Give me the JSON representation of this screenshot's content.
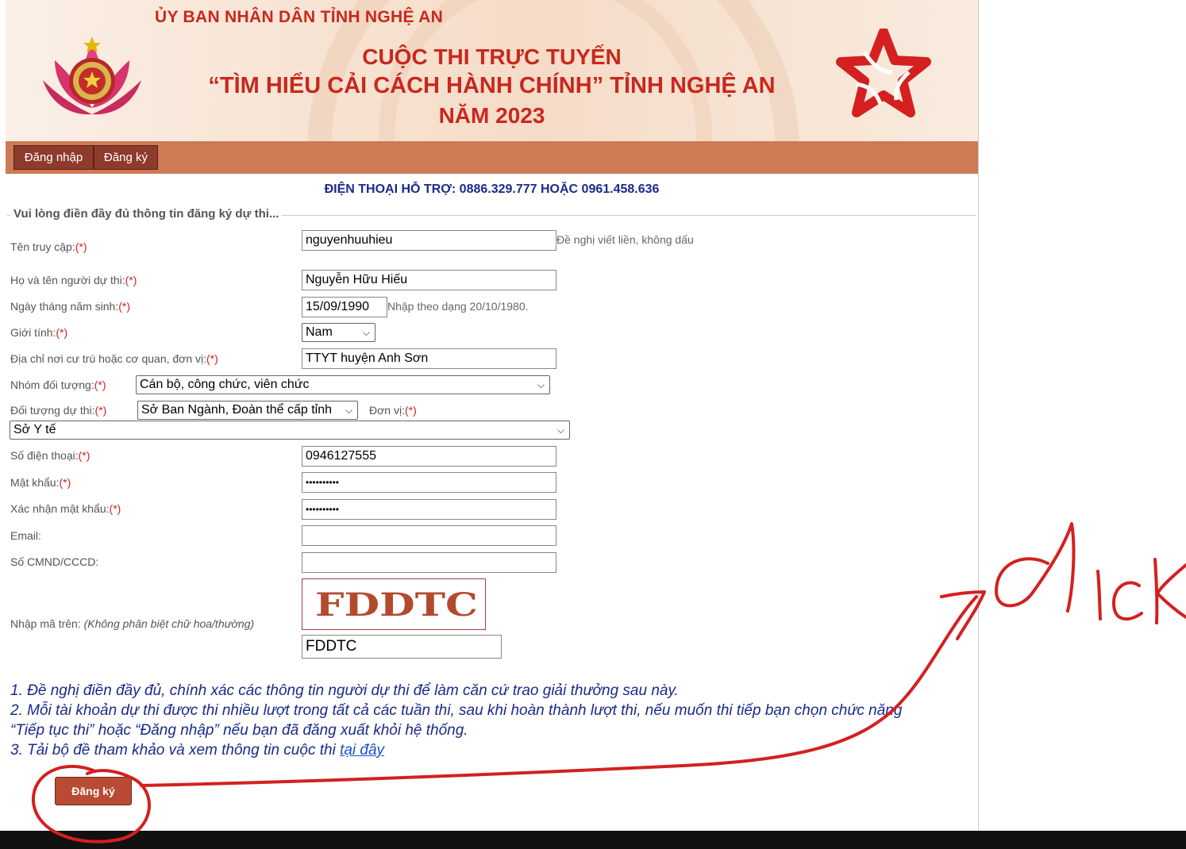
{
  "header": {
    "org": "ỦY BAN NHÂN DÂN TỈNH NGHỆ AN",
    "title_line1": "CUỘC THI TRỰC TUYẾN",
    "title_line2": "“TÌM HIỂU CẢI CÁCH HÀNH CHÍNH” TỈNH NGHỆ AN",
    "title_line3": "NĂM 2023"
  },
  "nav": {
    "login": "Đăng nhập",
    "register": "Đăng ký"
  },
  "hotline": "ĐIỆN THOẠI HỖ TRỢ: 0886.329.777 HOẶC 0961.458.636",
  "form": {
    "legend": "Vui lòng điền đầy đủ thông tin đăng ký dự thi...",
    "required_mark": "(*)",
    "username": {
      "label": "Tên truy cập:",
      "value": "nguyenhuuhieu",
      "hint": "Đề nghị viết liền, không dấu"
    },
    "fullname": {
      "label": "Họ và tên người dự thi:",
      "value": "Nguyễn Hữu Hiếu"
    },
    "dob": {
      "label": "Ngày tháng năm sinh:",
      "value": "15/09/1990",
      "hint": "Nhập theo dạng 20/10/1980."
    },
    "gender": {
      "label": "Giới tính:",
      "value": "Nam"
    },
    "address": {
      "label": "Địa chỉ nơi cư trú hoặc cơ quan, đơn vị:",
      "value": "TTYT huyện Anh Sơn"
    },
    "group": {
      "label": "Nhóm đối tượng:",
      "value": "Cán bộ, công chức, viên chức"
    },
    "target": {
      "label": "Đối tượng dự thi:",
      "value": "Sở Ban Ngành, Đoàn thể cấp tỉnh"
    },
    "unit": {
      "label": "Đơn vị:",
      "value": "Sở Y tế"
    },
    "phone": {
      "label": "Số điện thoại:",
      "value": "0946127555"
    },
    "password": {
      "label": "Mật khẩu:",
      "value": "••••••••••"
    },
    "confirm": {
      "label": "Xác nhận mật khẩu:",
      "value": "••••••••••"
    },
    "email": {
      "label": "Email:",
      "value": ""
    },
    "idcard": {
      "label": "Số CMND/CCCD:",
      "value": ""
    },
    "captcha": {
      "label": "Nhập mã trên:",
      "label_note": "(Không phân biệt chữ hoa/thường)",
      "image_text": "FDDTC",
      "value": "FDDTC"
    }
  },
  "notes": {
    "n1": "1. Đề nghị điền đầy đủ, chính xác các thông tin người dự thi để làm căn cứ trao giải thưởng sau này.",
    "n2": "2. Mỗi tài khoản dự thi được thi nhiều lượt trong tất cả các tuần thi, sau khi hoàn thành lượt thi, nếu muốn thi tiếp bạn chọn chức năng",
    "n2b": "“Tiếp tục thi” hoặc “Đăng nhập” nếu bạn đã đăng xuất khỏi hệ thống.",
    "n3": "3. Tải bộ đề tham khảo và xem thông tin cuộc thi ",
    "n3_link": "tại đây "
  },
  "submit": "Đăng ký",
  "annotation": {
    "text": "click",
    "color": "#d42020"
  },
  "colors": {
    "nav_bar": "#cd7a55",
    "nav_button": "#8e3a2c",
    "title_red": "#c8281e",
    "hotline_blue": "#1a2a8a",
    "submit": "#b94a34"
  }
}
